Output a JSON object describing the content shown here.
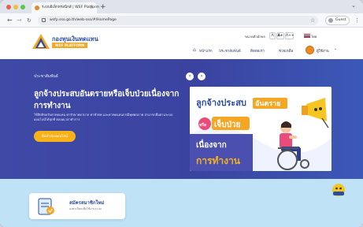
{
  "browser": {
    "tab_title": "ระบบอิเล็กทรอนิกส์ | WSF Platform",
    "tab_close": "×",
    "new_tab": "+",
    "tab_menu": "⌄",
    "url": "wsfp.sso.go.th/web-sso/#/HomePage",
    "guest_label": "Guest"
  },
  "header": {
    "logo_title": "กองทุนเงินทดแทน",
    "logo_subtitle": "WSF PLATFORM",
    "font_size_label": "ขนาดตัวอักษร",
    "font_small": "A",
    "font_medium": "A+",
    "font_large": "A++",
    "language": "ไทย",
    "menu": {
      "home": "หน้าแรก",
      "item2": "ประชาสัมพันธ์",
      "item3": "ติดต่อเรา",
      "item4": "ช่วยเหลือ"
    },
    "user_name": "ผู้ใช้งาน"
  },
  "hero": {
    "kicker": "ประชาสัมพันธ์",
    "title": "ลูกจ้างประสบอันตรายหรือเจ็บป่วยเนื่องจากการทำงาน",
    "description": "ใช้สิทธิขอรับค่าทดแทน ค่ารักษาพยาบาล ค่าทำศพ และค่าทดแทนกรณีทุพพลภาพ สามารถยื่นผ่านระบบออนไลน์ได้ทุกที่ ตลอดเวลาทำการ",
    "cta": "ยื่นคำร้องออนไลน์",
    "prev": "‹",
    "next": "›",
    "banner_line1": "ลูกจ้างประสบ",
    "banner_highlight": "อันตราย",
    "banner_or": "หรือ",
    "banner_line2": "เจ็บป่วย",
    "banner_line3": "เนื่องจาก",
    "banner_line4": "การทำงาน"
  },
  "lower": {
    "card_title": "สมัครสมาชิกใหม่",
    "card_subtitle": "ลงทะเบียนเพื่อใช้งานระบบ"
  },
  "colors": {
    "hero_bg": "#3f49a6",
    "accent_orange": "#f7b21a",
    "brand_blue": "#2c4ca0",
    "lower_bg": "#bfe2f7"
  }
}
